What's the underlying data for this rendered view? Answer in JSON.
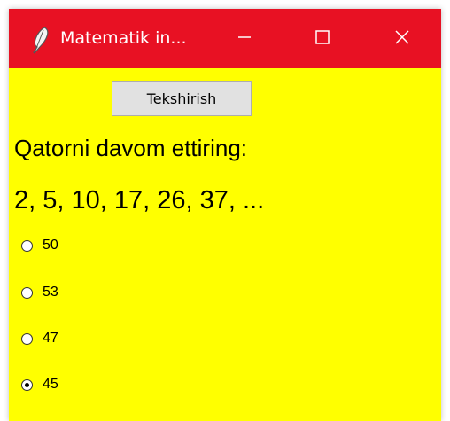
{
  "window": {
    "title": "Matematik in...",
    "titlebar_color": "#e81123",
    "background_color": "#ffff00",
    "app_icon": "feather-icon",
    "controls": {
      "minimize": "minimize-icon",
      "maximize": "maximize-icon",
      "close": "close-icon"
    }
  },
  "check_button": {
    "label": "Tekshirish"
  },
  "question": {
    "text": "Qatorni davom ettiring:",
    "sequence": "2, 5, 10, 17, 26, 37, ..."
  },
  "options": [
    {
      "label": "50",
      "selected": false
    },
    {
      "label": "53",
      "selected": false
    },
    {
      "label": "47",
      "selected": false
    },
    {
      "label": "45",
      "selected": true
    }
  ]
}
